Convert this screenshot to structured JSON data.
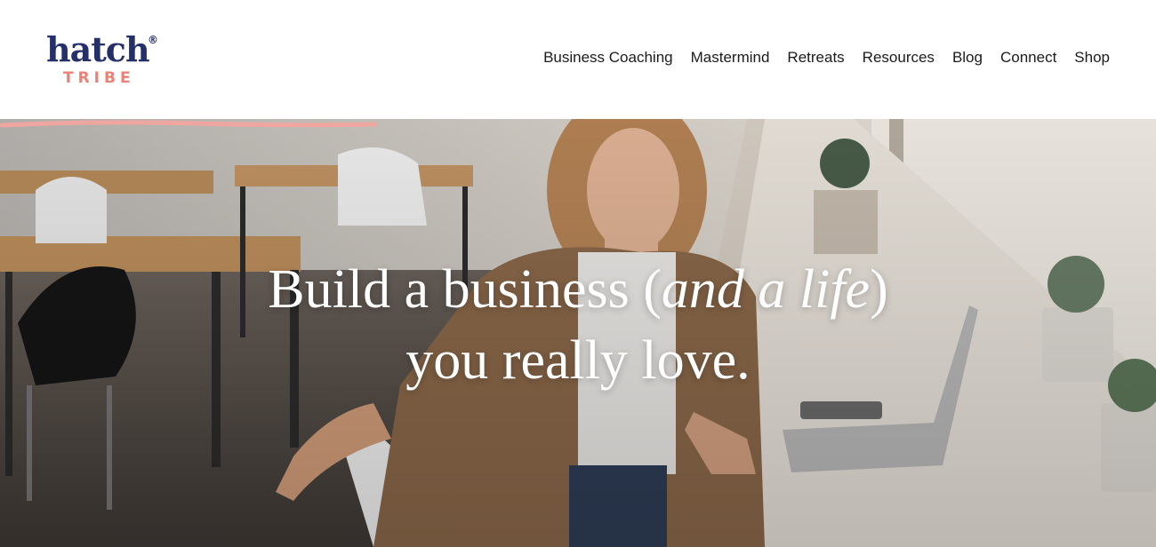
{
  "brand": {
    "name": "hatch",
    "registered": "®",
    "subtitle": "TRIBE"
  },
  "nav": {
    "items": [
      {
        "label": "Business Coaching"
      },
      {
        "label": "Mastermind"
      },
      {
        "label": "Retreats"
      },
      {
        "label": "Resources"
      },
      {
        "label": "Blog"
      },
      {
        "label": "Connect"
      },
      {
        "label": "Shop"
      }
    ]
  },
  "hero": {
    "line1_a": "Build a business ",
    "line1_paren_open": "(",
    "line1_italic": "and a life",
    "line1_paren_close": ")",
    "line2": "you really love."
  },
  "colors": {
    "brand_navy": "#25306b",
    "brand_coral": "#ee7f74",
    "underline_pink": "#efa6a0"
  }
}
